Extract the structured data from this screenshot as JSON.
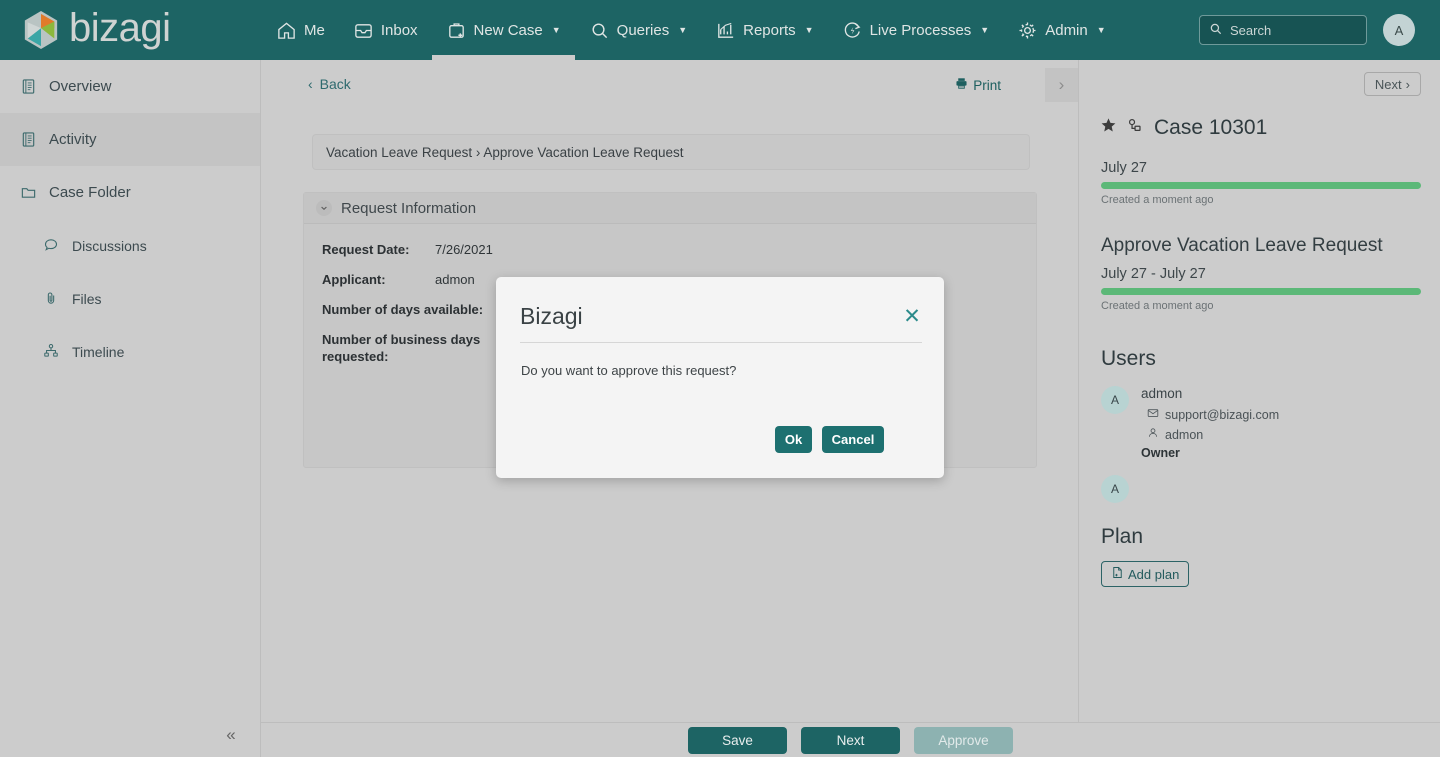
{
  "brand": {
    "name": "bizagi",
    "logo_icon": "bizagi-hexagon-logo",
    "primary_color": "#1d6464",
    "accent_color": "#2b8b8b",
    "progress_color": "#5cb878"
  },
  "topnav": {
    "items": [
      {
        "label": "Me",
        "icon": "home-icon",
        "caret": false,
        "active": false
      },
      {
        "label": "Inbox",
        "icon": "inbox-icon",
        "caret": false,
        "active": false
      },
      {
        "label": "New Case",
        "icon": "new-case-icon",
        "caret": true,
        "active": true
      },
      {
        "label": "Queries",
        "icon": "search-icon",
        "caret": true,
        "active": false
      },
      {
        "label": "Reports",
        "icon": "reports-chart-icon",
        "caret": true,
        "active": false
      },
      {
        "label": "Live Processes",
        "icon": "live-processes-icon",
        "caret": true,
        "active": false
      },
      {
        "label": "Admin",
        "icon": "gear-icon",
        "caret": true,
        "active": false
      }
    ],
    "caret_glyph": "▼",
    "search": {
      "placeholder": "Search",
      "value": "",
      "icon": "search-icon"
    },
    "avatar": {
      "initial": "A"
    }
  },
  "sidebar": {
    "items": [
      {
        "label": "Overview",
        "icon": "document-list-icon",
        "selected": false,
        "sub": false
      },
      {
        "label": "Activity",
        "icon": "document-list-icon",
        "selected": true,
        "sub": false
      },
      {
        "label": "Case Folder",
        "icon": "folder-icon",
        "selected": false,
        "sub": false
      },
      {
        "label": "Discussions",
        "icon": "chat-bubble-icon",
        "selected": false,
        "sub": true
      },
      {
        "label": "Files",
        "icon": "paperclip-icon",
        "selected": false,
        "sub": true
      },
      {
        "label": "Timeline",
        "icon": "timeline-icon",
        "selected": false,
        "sub": true
      }
    ],
    "collapse_icon": "chevron-double-left-icon",
    "collapse_glyph": "«"
  },
  "center": {
    "back_label": "Back",
    "back_icon": "chevron-left-icon",
    "back_glyph": "‹",
    "print_label": "Print",
    "print_icon": "printer-icon",
    "forward_icon": "chevron-right-icon",
    "forward_glyph": "›",
    "breadcrumb": "Vacation Leave Request › Approve Vacation Leave Request",
    "form": {
      "section_title": "Request Information",
      "collapse_icon": "chevron-down-icon",
      "collapse_glyph": "⌄",
      "fields": [
        {
          "label": "Request Date:",
          "value": "7/26/2021",
          "wide": false
        },
        {
          "label": "Applicant:",
          "value": "admon",
          "wide": false
        },
        {
          "label": "Number of days available:",
          "value": "",
          "wide": true
        },
        {
          "label": "Number of business days requested:",
          "value": "",
          "wide": true
        }
      ]
    }
  },
  "rightpanel": {
    "next_label": "Next",
    "next_icon": "chevron-right-icon",
    "next_glyph": "›",
    "favorite_icon": "star-icon",
    "process_icon": "process-node-icon",
    "case_title": "Case 10301",
    "case_date": "July 27",
    "case_created": "Created a moment ago",
    "task_title": "Approve Vacation Leave Request",
    "task_date_range": "July 27 - July 27",
    "task_created": "Created a moment ago",
    "case_progress_percent": 100,
    "task_progress_percent": 100,
    "users_heading": "Users",
    "users": [
      {
        "avatar_initial": "A",
        "name": "admon",
        "email": "support@bizagi.com",
        "email_icon": "envelope-icon",
        "username": "admon",
        "username_icon": "person-icon",
        "role": "Owner"
      },
      {
        "avatar_initial": "A",
        "name": "",
        "email": "",
        "username": "",
        "role": ""
      }
    ],
    "plan_heading": "Plan",
    "add_plan_label": "Add plan",
    "add_plan_icon": "document-add-icon"
  },
  "bottombar": {
    "buttons": [
      {
        "label": "Save",
        "disabled": false
      },
      {
        "label": "Next",
        "disabled": false
      },
      {
        "label": "Approve",
        "disabled": true
      }
    ]
  },
  "modal": {
    "title": "Bizagi",
    "close_icon": "close-icon",
    "close_glyph": "✕",
    "message": "Do you want to approve this request?",
    "ok_label": "Ok",
    "cancel_label": "Cancel"
  }
}
